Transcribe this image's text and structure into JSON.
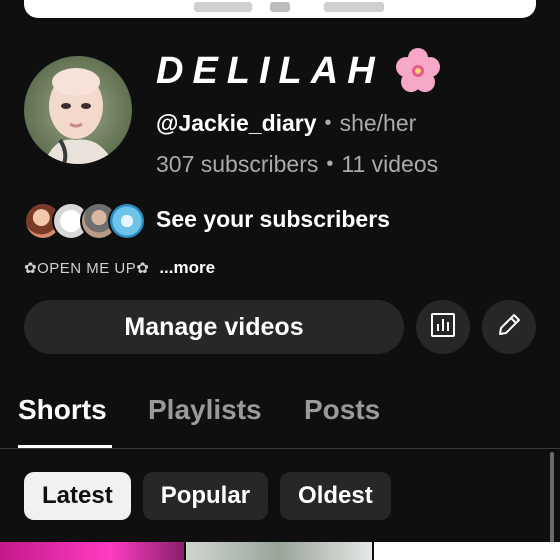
{
  "channel": {
    "name": "DELILAH",
    "handle": "@Jackie_diary",
    "pronouns": "she/her",
    "subscribers": "307 subscribers",
    "videos": "11 videos",
    "separator": "•"
  },
  "subscribers_link": {
    "label": "See your subscribers"
  },
  "description": {
    "text": "✿OPEN ME UP✿",
    "more": "...more"
  },
  "actions": {
    "manage_label": "Manage videos",
    "analytics_icon": "analytics-icon",
    "edit_icon": "edit-pencil-icon"
  },
  "tabs": [
    {
      "label": "Shorts",
      "active": true
    },
    {
      "label": "Playlists",
      "active": false
    },
    {
      "label": "Posts",
      "active": false
    }
  ],
  "filters": [
    {
      "label": "Latest",
      "selected": true
    },
    {
      "label": "Popular",
      "selected": false
    },
    {
      "label": "Oldest",
      "selected": false
    }
  ],
  "colors": {
    "background": "#0f0f0f",
    "button_bg": "#272727",
    "muted_text": "#aaaaaa",
    "selected_chip_bg": "#f1f1f1"
  }
}
